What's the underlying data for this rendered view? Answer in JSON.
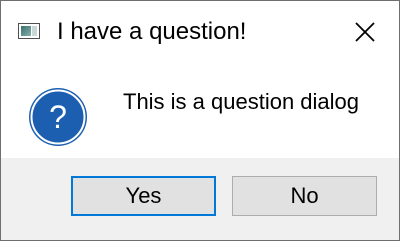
{
  "window": {
    "title": "I have a question!",
    "app_icon": "window-app-icon",
    "close_icon": "close-icon"
  },
  "content": {
    "icon": "question-icon",
    "icon_glyph": "?",
    "message": "This is a question dialog"
  },
  "buttons": {
    "yes_label": "Yes",
    "no_label": "No",
    "default": "Yes"
  },
  "colors": {
    "icon_blue": "#1c5fb0",
    "focus_border": "#0078d7",
    "button_bar_bg": "#f0f0f0",
    "button_bg": "#e1e1e1"
  }
}
